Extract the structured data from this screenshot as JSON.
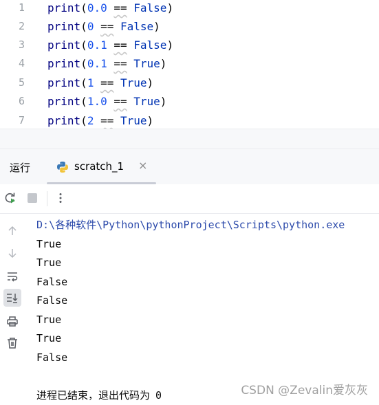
{
  "editor": {
    "lines": [
      {
        "number": "1",
        "fn": "print",
        "open": "(",
        "left": "0.0",
        "op": "==",
        "right": "False",
        "close": ")"
      },
      {
        "number": "2",
        "fn": "print",
        "open": "(",
        "left": "0",
        "op": "==",
        "right": "False",
        "close": ")"
      },
      {
        "number": "3",
        "fn": "print",
        "open": "(",
        "left": "0.1",
        "op": "==",
        "right": "False",
        "close": ")"
      },
      {
        "number": "4",
        "fn": "print",
        "open": "(",
        "left": "0.1",
        "op": "==",
        "right": "True",
        "close": ")"
      },
      {
        "number": "5",
        "fn": "print",
        "open": "(",
        "left": "1",
        "op": "==",
        "right": "True",
        "close": ")"
      },
      {
        "number": "6",
        "fn": "print",
        "open": "(",
        "left": "1.0",
        "op": "==",
        "right": "True",
        "close": ")"
      },
      {
        "number": "7",
        "fn": "print",
        "open": "(",
        "left": "2",
        "op": "==",
        "right": "True",
        "close": ")"
      }
    ]
  },
  "run_window": {
    "title": "运行",
    "tab_label": "scratch_1",
    "tab_close": "×"
  },
  "icons": {
    "rerun": "rerun-icon",
    "stop": "stop-icon",
    "more": "more-vertical-icon",
    "up": "arrow-up-icon",
    "down": "arrow-down-icon",
    "soft_wrap": "soft-wrap-icon",
    "scroll_end": "scroll-to-end-icon",
    "print": "print-icon",
    "trash": "trash-icon"
  },
  "console": {
    "command": "D:\\各种软件\\Python\\pythonProject\\Scripts\\python.exe",
    "output": [
      "True",
      "True",
      "False",
      "False",
      "True",
      "True",
      "False"
    ],
    "exit_text": "进程已结束，退出代码为",
    "exit_code": "0"
  },
  "watermark": "CSDN @Zevalin爱灰灰",
  "colors": {
    "function": "#000080",
    "number": "#1750eb",
    "keyword": "#0033b3",
    "command_path": "#2d4bab"
  }
}
